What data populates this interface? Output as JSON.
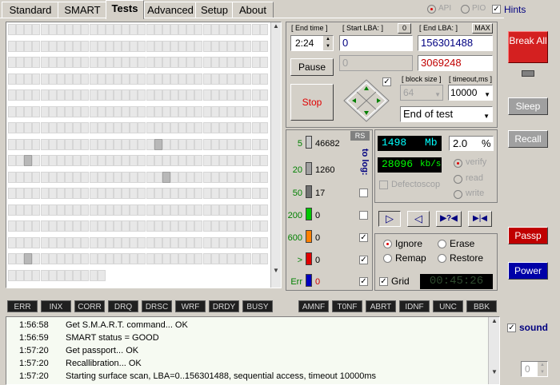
{
  "tabs": [
    {
      "label": "Standard"
    },
    {
      "label": "SMART"
    },
    {
      "label": "Tests"
    },
    {
      "label": "Advanced"
    },
    {
      "label": "Setup"
    },
    {
      "label": "About"
    }
  ],
  "api_label": "API",
  "pio_label": "PIO",
  "hints_label": "Hints",
  "end_time": {
    "label": "[ End time ]",
    "value": "2:24"
  },
  "start_lba": {
    "label": "[ Start LBA: ]",
    "reset": "0",
    "value": "0",
    "value2": "0"
  },
  "end_lba": {
    "label": "[ End LBA: ]",
    "max": "MAX",
    "value": "156301488",
    "value2": "3069248"
  },
  "pause_label": "Pause",
  "stop_label": "Stop",
  "block_size": {
    "label": "[ block size ]",
    "value": "64"
  },
  "timeout": {
    "label": "[ timeout,ms ]",
    "value": "10000"
  },
  "end_action": "End of test",
  "break_all": "Break All",
  "sleep": "Sleep",
  "recall": "Recall",
  "passp": "Passp",
  "power": "Power",
  "rs_label": "RS",
  "to_log_label": "to log:",
  "ranges": [
    {
      "label": "5",
      "count": "46682",
      "color": "#c8c8c8"
    },
    {
      "label": "20",
      "count": "1260",
      "color": "#a0a0a0"
    },
    {
      "label": "50",
      "count": "17",
      "color": "#707070"
    },
    {
      "label": "200",
      "count": "0",
      "color": "#00c800"
    },
    {
      "label": "600",
      "count": "0",
      "color": "#ff8000"
    },
    {
      "label": ">",
      "count": "0",
      "color": "#e00000"
    },
    {
      "label": "Err",
      "count": "0",
      "color": "#0000c0"
    }
  ],
  "stats": {
    "mb": "1498",
    "mb_unit": "Mb",
    "pct": "2.0",
    "pct_unit": "%",
    "speed": "28096",
    "speed_unit": "kb/s"
  },
  "defectoscope": "Defectoscop",
  "verify": "verify",
  "read": "read",
  "write": "write",
  "mode": {
    "ignore": "Ignore",
    "erase": "Erase",
    "remap": "Remap",
    "restore": "Restore"
  },
  "grid_label": "Grid",
  "timer": "00:45:26",
  "status_flags": [
    "ERR",
    "INX",
    "CORR",
    "DRQ",
    "DRSC",
    "WRF",
    "DRDY",
    "BUSY",
    "AMNF",
    "T0NF",
    "ABRT",
    "IDNF",
    "UNC",
    "BBK"
  ],
  "sound_label": "sound",
  "sound_value": "0",
  "log": [
    {
      "time": "1:56:58",
      "msg": "Get S.M.A.R.T. command... OK"
    },
    {
      "time": "1:56:59",
      "msg": "SMART status = GOOD"
    },
    {
      "time": "1:57:20",
      "msg": "Get passport... OK"
    },
    {
      "time": "1:57:20",
      "msg": "Recallibration... OK"
    },
    {
      "time": "1:57:20",
      "msg": "Starting surface scan, LBA=0..156301488, sequential access, timeout 10000ms"
    }
  ],
  "grid_fill": {
    "rows_full": 15,
    "cols": 32,
    "last_row_cols": 12
  }
}
